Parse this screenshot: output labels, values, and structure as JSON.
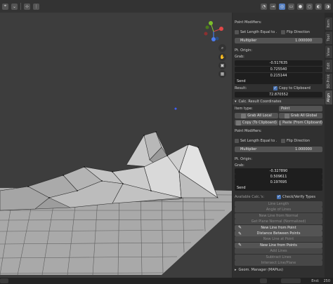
{
  "sidebar_tabs": [
    "Item",
    "Tool",
    "View",
    "Edit",
    "3D-Print",
    "Align"
  ],
  "panel": {
    "top_modifiers": {
      "title": "Point Modifiers:",
      "set_length": "Set Length Equal to ...",
      "flip": "Flip Direction",
      "multiplier_label": "Multiplier",
      "multiplier_value": "1.000000"
    },
    "top_origin": {
      "title": "Pt. Origin:",
      "grab": "Grab:",
      "values": [
        "-0.517635",
        "0.725540",
        "0.215144"
      ],
      "send": "Send"
    },
    "result_label": "Result:",
    "result_value": "72.870552",
    "copy_to_clipboard": "Copy to Clipboard",
    "section_title": "Calc. Result Coordinates",
    "item_type_label": "Item type:",
    "item_type_value": "Point",
    "grab_all_local": "Grab All Local",
    "grab_all_global": "Grab All Global",
    "copy_to_clipboard_btn": "Copy (To Clipboard)",
    "paste_from_clipboard": "Paste (From Clipboard)",
    "bottom_modifiers": {
      "title": "Point Modifiers:",
      "set_length": "Set Length Equal to ...",
      "flip": "Flip Direction",
      "multiplier_label": "Multiplier",
      "multiplier_value": "1.000000"
    },
    "bottom_origin": {
      "title": "Pt. Origin:",
      "grab": "Grab:",
      "values": [
        "-0.327890",
        "0.509611",
        "0.197695"
      ],
      "send": "Send"
    },
    "available_label": "Available Calc.'s:",
    "check_verify": "Check/Verify Types",
    "calc_items": [
      {
        "label": "Line Length",
        "enabled": false
      },
      {
        "label": "Angle of Lines",
        "enabled": false
      },
      {
        "label": "New Line from Normal",
        "enabled": false
      },
      {
        "label": "Get Plane Normal (Normalized)",
        "enabled": false
      },
      {
        "label": "New Line from Point",
        "enabled": true
      },
      {
        "label": "Distance Between Points",
        "enabled": true
      },
      {
        "label": "New Line at Point",
        "enabled": false
      },
      {
        "label": "New Line from Points",
        "enabled": true
      },
      {
        "label": "Add Lines",
        "enabled": false
      },
      {
        "label": "Subtract Lines",
        "enabled": false
      },
      {
        "label": "Intersect Line/Plane",
        "enabled": false
      }
    ],
    "geom_manager": "Geom. Manager (MAPlus)"
  },
  "status": {
    "end_label": "End:",
    "end_value": "250"
  },
  "colors": {
    "accent": "#4772b3",
    "panel_bg": "#303030",
    "viewport_bg": "#3d3d3d"
  }
}
